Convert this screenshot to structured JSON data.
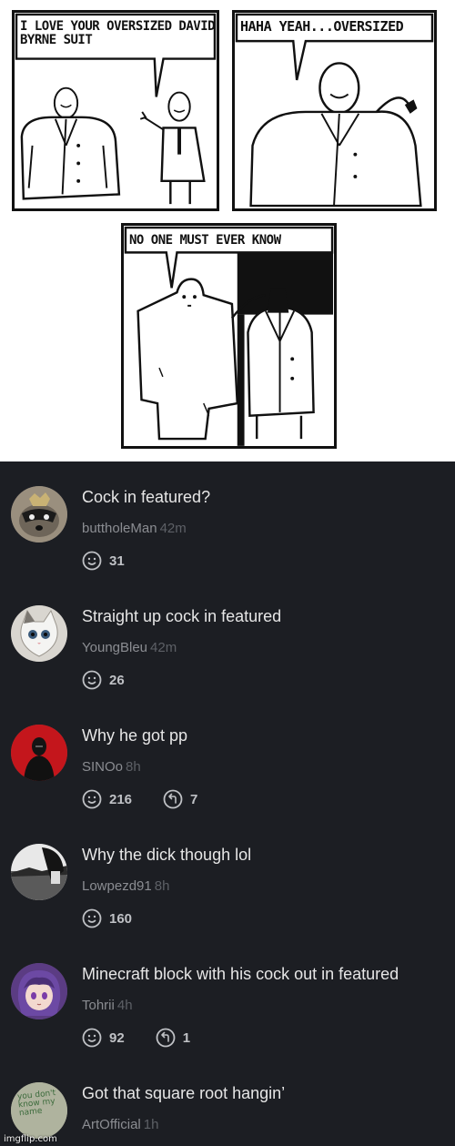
{
  "comic": {
    "panel1": {
      "bubble": "I LOVE YOUR OVERSIZED DAVID BYRNE SUIT"
    },
    "panel2": {
      "bubble": "HAHA YEAH...OVERSIZED"
    },
    "panel3": {
      "bubble": "NO ONE MUST EVER KNOW"
    }
  },
  "comments": [
    {
      "text": "Cock in featured?",
      "user": "buttholeMan",
      "time": "42m",
      "likes": "31",
      "replies": null,
      "avatar": "raccoon"
    },
    {
      "text": "Straight up cock in featured",
      "user": "YoungBleu",
      "time": "42m",
      "likes": "26",
      "replies": null,
      "avatar": "kitten"
    },
    {
      "text": "Why he got pp",
      "user": "SINOo",
      "time": "8h",
      "likes": "216",
      "replies": "7",
      "avatar": "red-figure"
    },
    {
      "text": "Why the dick though lol",
      "user": "Lowpezd91",
      "time": "8h",
      "likes": "160",
      "replies": null,
      "avatar": "bw-landscape"
    },
    {
      "text": "Minecraft block with his cock out in featured",
      "user": "Tohrii",
      "time": "4h",
      "likes": "92",
      "replies": "1",
      "avatar": "anime-girl"
    },
    {
      "text": "Got that square root hangin’",
      "user": "ArtOfficial",
      "time": "1h",
      "likes": null,
      "replies": null,
      "avatar": "graffiti",
      "avatar_text": "you don't know my name"
    }
  ],
  "watermark": "imgflip.com",
  "colors": {
    "background": "#1c1e23",
    "comment_text": "#e6e6e6",
    "username": "#8b8d92",
    "timestamp": "#5d6066",
    "count": "#bfc1c5"
  },
  "icons": {
    "like": "smiley-reaction-icon",
    "reply": "repost-arrow-icon"
  }
}
